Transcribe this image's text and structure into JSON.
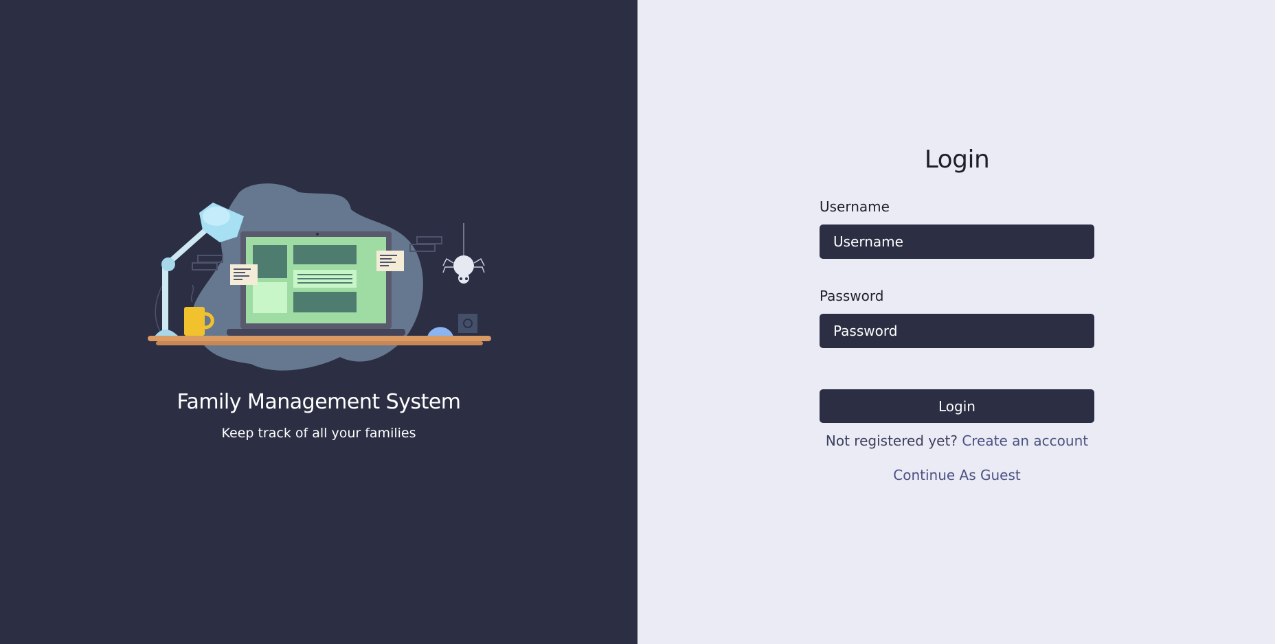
{
  "branding": {
    "title": "Family Management System",
    "subtitle": "Keep track of all your families",
    "illustration_icon": "desk-workspace-illustration"
  },
  "login_form": {
    "title": "Login",
    "username": {
      "label": "Username",
      "placeholder": "Username",
      "value": ""
    },
    "password": {
      "label": "Password",
      "placeholder": "Password",
      "value": ""
    },
    "submit_label": "Login",
    "register_prompt": "Not registered yet?",
    "register_link": "Create an account",
    "guest_link": "Continue As Guest"
  },
  "colors": {
    "left_panel_bg": "#2c2e43",
    "right_panel_bg": "#ebebf5",
    "input_bg": "#2c2e43",
    "link": "#4a5081",
    "text_dark": "#1f1f2b"
  }
}
